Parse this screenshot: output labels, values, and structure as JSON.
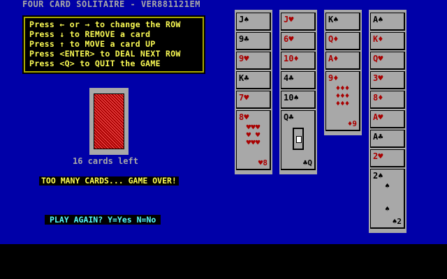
{
  "title": "FOUR CARD SOLITAIRE - VER881121EM",
  "help": [
    "Press ← or → to change the ROW",
    "Press ↓ to REMOVE a card",
    "Press ↑ to MOVE a card UP",
    "Press <ENTER> to DEAL NEXT ROW",
    "Press <Q> to QUIT the GAME"
  ],
  "deck": {
    "label": "16 cards left"
  },
  "messages": {
    "game_over": "TOO MANY CARDS... GAME OVER!",
    "play_again": "PLAY AGAIN? Y=Yes N=No"
  },
  "columns": [
    {
      "cards": [
        "J♠",
        "9♣",
        "9♥",
        "K♣",
        "7♥"
      ],
      "last": {
        "rank": "8",
        "suit": "♥",
        "corner": "8♥",
        "br": "♥8",
        "pips": "♥♥♥\n♥ ♥\n♥♥♥"
      }
    },
    {
      "cards": [
        "J♥",
        "6♥",
        "10♦",
        "4♣",
        "10♠"
      ],
      "last": {
        "corner": "Q♣",
        "br": "♣Q",
        "pips": ""
      }
    },
    {
      "cards": [
        "K♠",
        "Q♦",
        "A♦"
      ],
      "last": {
        "corner": "9♦",
        "br": "♦9",
        "pips": "♦♦♦\n♦♦♦\n♦♦♦"
      }
    },
    {
      "cards": [
        "A♠",
        "K♦",
        "Q♥",
        "3♥",
        "8♦",
        "A♥",
        "A♣",
        "2♥"
      ],
      "last": {
        "corner": "2♠",
        "br": "♠2",
        "pips": "♠\n\n\n♠"
      }
    }
  ],
  "colors": {
    "background": "#0000a8",
    "card": "#a8a8a8",
    "red_suit": "#a80000",
    "black_suit": "#000000",
    "help_text": "#fcfc54",
    "play_again_text": "#54fcfc"
  }
}
